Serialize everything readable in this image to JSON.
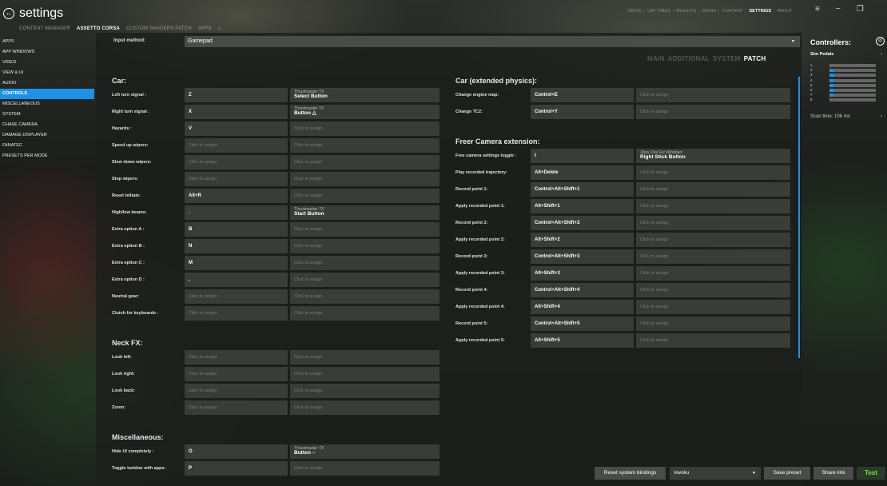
{
  "app": {
    "title": "settings"
  },
  "subnav": [
    "CONTENT MANAGER",
    "ASSETTO CORSA",
    "CUSTOM SHADERS PATCH",
    "APPS"
  ],
  "topnav": [
    "DRIVE",
    "LAP TIMES",
    "RESULTS",
    "MEDIA",
    "CONTENT",
    "SETTINGS",
    "ABOUT"
  ],
  "sidebar": [
    "APPS",
    "APP WINDOWS",
    "VIDEO",
    "VIEW & UI",
    "AUDIO",
    "CONTROLS",
    "MISCELLANEOUS",
    "SYSTEM",
    "CHASE CAMERA",
    "DAMAGE DISPLAYER",
    "FANATEC",
    "PRESETS PER MODE"
  ],
  "input": {
    "label": "Input method:",
    "value": "Gamepad"
  },
  "subtabs": [
    "MAIN",
    "ADDITIONAL",
    "SYSTEM",
    "PATCH"
  ],
  "placeholder": "Click to assign",
  "left_sections": [
    {
      "title": "Car:",
      "rows": [
        {
          "label": "Left turn signal :",
          "key": "Z",
          "alt_small": "Thrustmaster TX",
          "alt": "Select Button"
        },
        {
          "label": "Right turn signal :",
          "key": "X",
          "alt_small": "Thrustmaster TX",
          "alt": "Button △"
        },
        {
          "label": "Hazards :",
          "key": "V",
          "alt": ""
        },
        {
          "label": "Speed up wipers:",
          "key": "",
          "alt": ""
        },
        {
          "label": "Slow down wipers:",
          "key": "",
          "alt": ""
        },
        {
          "label": "Stop wipers:",
          "key": "",
          "alt": ""
        },
        {
          "label": "Reset telltale:",
          "key": "Alt+R",
          "alt": ""
        },
        {
          "label": "High/low beams:",
          "key": ".",
          "alt_small": "Thrustmaster TX",
          "alt": "Start Button"
        },
        {
          "label": "Extra option A :",
          "key": "B",
          "alt": ""
        },
        {
          "label": "Extra option B :",
          "key": "N",
          "alt": ""
        },
        {
          "label": "Extra option C :",
          "key": "M",
          "alt": ""
        },
        {
          "label": "Extra option D :",
          "key": ",",
          "alt": ""
        },
        {
          "label": "Neutral gear:",
          "key": "",
          "alt": ""
        },
        {
          "label": "Clutch for keyboards :",
          "key": "",
          "alt": ""
        }
      ]
    },
    {
      "title": "Neck FX:",
      "rows": [
        {
          "label": "Look left:",
          "key": "",
          "alt": ""
        },
        {
          "label": "Look right:",
          "key": "",
          "alt": ""
        },
        {
          "label": "Look back:",
          "key": "",
          "alt": ""
        },
        {
          "label": "Zoom:",
          "key": "",
          "alt": ""
        }
      ]
    },
    {
      "title": "Miscellaneous:",
      "rows": [
        {
          "label": "Hide UI completely :",
          "key": "O",
          "alt_small": "Thrustmaster TX",
          "alt": "Button ○"
        },
        {
          "label": "Toggle taskbar with apps:",
          "key": "P",
          "alt": ""
        }
      ]
    }
  ],
  "right_sections": [
    {
      "title": "Car (extended physics):",
      "rows": [
        {
          "label": "Change engine map:",
          "key": "Control+E",
          "alt": ""
        },
        {
          "label": "Change TC2:",
          "key": "Control+Y",
          "alt": ""
        }
      ]
    },
    {
      "title": "Freer Camera extension:",
      "rows": [
        {
          "label": "Free camera settings toggle :",
          "key": "I",
          "alt_small": "Xbox One For Windows",
          "alt": "Right Stick Button"
        },
        {
          "label": "Play recorded trajectory:",
          "key": "Alt+Delete",
          "alt": ""
        },
        {
          "label": "Record point 1:",
          "key": "Control+Alt+Shift+1",
          "alt": ""
        },
        {
          "label": "Apply recorded point 1:",
          "key": "Alt+Shift+1",
          "alt": ""
        },
        {
          "label": "Record point 2:",
          "key": "Control+Alt+Shift+2",
          "alt": ""
        },
        {
          "label": "Apply recorded point 2:",
          "key": "Alt+Shift+2",
          "alt": ""
        },
        {
          "label": "Record point 3:",
          "key": "Control+Alt+Shift+3",
          "alt": ""
        },
        {
          "label": "Apply recorded point 3:",
          "key": "Alt+Shift+3",
          "alt": ""
        },
        {
          "label": "Record point 4:",
          "key": "Control+Alt+Shift+4",
          "alt": ""
        },
        {
          "label": "Apply recorded point 4:",
          "key": "Alt+Shift+4",
          "alt": ""
        },
        {
          "label": "Record point 5:",
          "key": "Control+Alt+Shift+5",
          "alt": ""
        },
        {
          "label": "Apply recorded point 5:",
          "key": "Alt+Shift+5",
          "alt": ""
        }
      ]
    }
  ],
  "controllers": {
    "title": "Controllers:",
    "device": "Sim Pedals",
    "axes": [
      {
        "n": "1",
        "value": 0
      },
      {
        "n": "2",
        "value": 0.08
      },
      {
        "n": "3",
        "value": 0.08
      },
      {
        "n": "4",
        "value": 0.08
      },
      {
        "n": "5",
        "value": 0.08
      },
      {
        "n": "6",
        "value": 0.08
      },
      {
        "n": "7",
        "value": 0.08
      },
      {
        "n": "8",
        "value": 0
      }
    ],
    "scan_time": "Scan time: 106 ms"
  },
  "bottom": {
    "reset": "Reset system bindings",
    "preset": "kwoku",
    "save": "Save preset",
    "share": "Share link",
    "test": "Test"
  },
  "colors": {
    "accent": "#1e90e6",
    "test": "#6be04a"
  }
}
